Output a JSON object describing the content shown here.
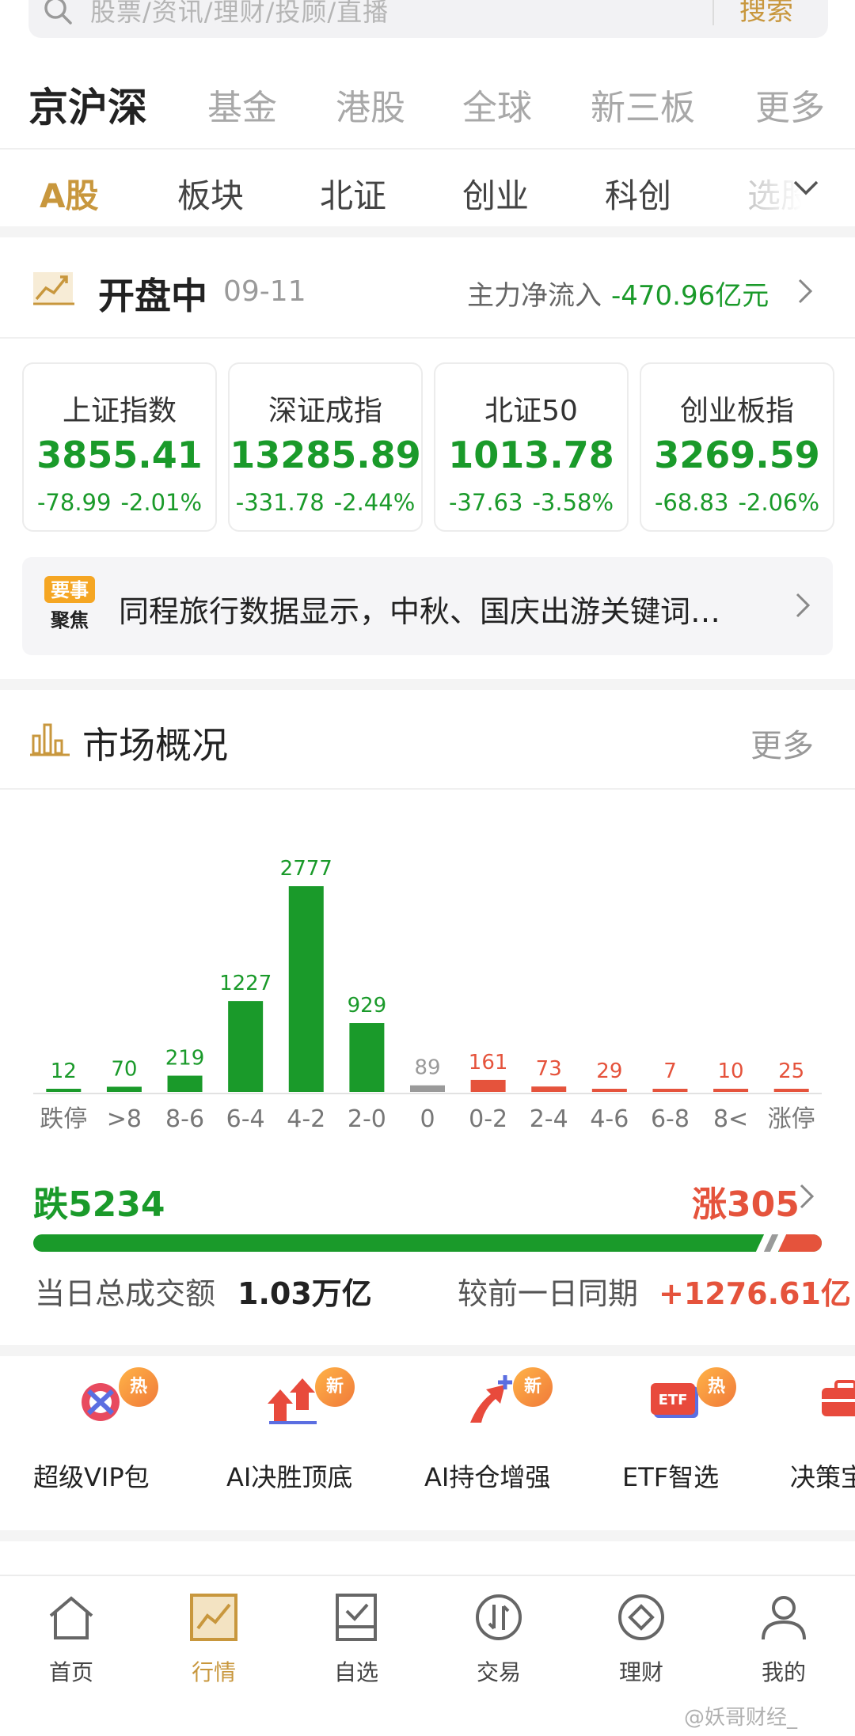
{
  "search": {
    "placeholder": "股票/资讯/理财/投顾/直播",
    "button": "搜索"
  },
  "main_tabs": [
    "京沪深",
    "基金",
    "港股",
    "全球",
    "新三板",
    "更多"
  ],
  "sub_tabs": [
    "A股",
    "板块",
    "北证",
    "创业",
    "科创",
    "选股"
  ],
  "status": {
    "title": "开盘中",
    "date": "09-11",
    "flow_label": "主力净流入",
    "flow_value": "-470.96亿元"
  },
  "indices": [
    {
      "name": "上证指数",
      "value": "3855.41",
      "change": "-78.99",
      "pct": "-2.01%"
    },
    {
      "name": "深证成指",
      "value": "13285.89",
      "change": "-331.78",
      "pct": "-2.44%"
    },
    {
      "name": "北证50",
      "value": "1013.78",
      "change": "-37.63",
      "pct": "-3.58%"
    },
    {
      "name": "创业板指",
      "value": "3269.59",
      "change": "-68.83",
      "pct": "-2.06%"
    }
  ],
  "news": {
    "badge_line1": "要事",
    "badge_line2": "聚焦",
    "text": "同程旅行数据显示，中秋、国庆出游关键词…"
  },
  "market": {
    "title": "市场概况",
    "more": "更多",
    "fall_total": "跌5234",
    "rise_total": "涨305",
    "fall_count": 5234,
    "flat_count": 89,
    "rise_count": 305,
    "volume_label": "当日总成交额",
    "volume_value": "1.03万亿",
    "compare_label": "较前一日同期",
    "compare_value": "+1276.61亿"
  },
  "chart_data": {
    "type": "bar",
    "categories": [
      "跌停",
      ">8",
      "8-6",
      "6-4",
      "4-2",
      "2-0",
      "0",
      "0-2",
      "2-4",
      "4-6",
      "6-8",
      "8<",
      "涨停"
    ],
    "values": [
      12,
      70,
      219,
      1227,
      2777,
      929,
      89,
      161,
      73,
      29,
      7,
      10,
      25
    ],
    "bar_colors": [
      "#1a9a2a",
      "#1a9a2a",
      "#1a9a2a",
      "#1a9a2a",
      "#1a9a2a",
      "#1a9a2a",
      "#9a9a9a",
      "#e5533c",
      "#e5533c",
      "#e5533c",
      "#e5533c",
      "#e5533c",
      "#e5533c"
    ],
    "ylim": [
      0,
      2777
    ]
  },
  "features": [
    {
      "label": "超级VIP包",
      "badge": "热",
      "icon": "vip-package-icon"
    },
    {
      "label": "AI决胜顶底",
      "badge": "新",
      "icon": "ai-top-bottom-icon"
    },
    {
      "label": "AI持仓增强",
      "badge": "新",
      "icon": "ai-position-icon"
    },
    {
      "label": "ETF智选",
      "badge": "热",
      "icon": "etf-icon"
    },
    {
      "label": "决策宝",
      "badge": "",
      "icon": "decision-icon"
    }
  ],
  "bottom_nav": [
    "首页",
    "行情",
    "自选",
    "交易",
    "理财",
    "我的"
  ],
  "watermark": "@妖哥财经_",
  "colors": {
    "green": "#1a9a2a",
    "red": "#e5533c",
    "gold": "#c8973d"
  }
}
